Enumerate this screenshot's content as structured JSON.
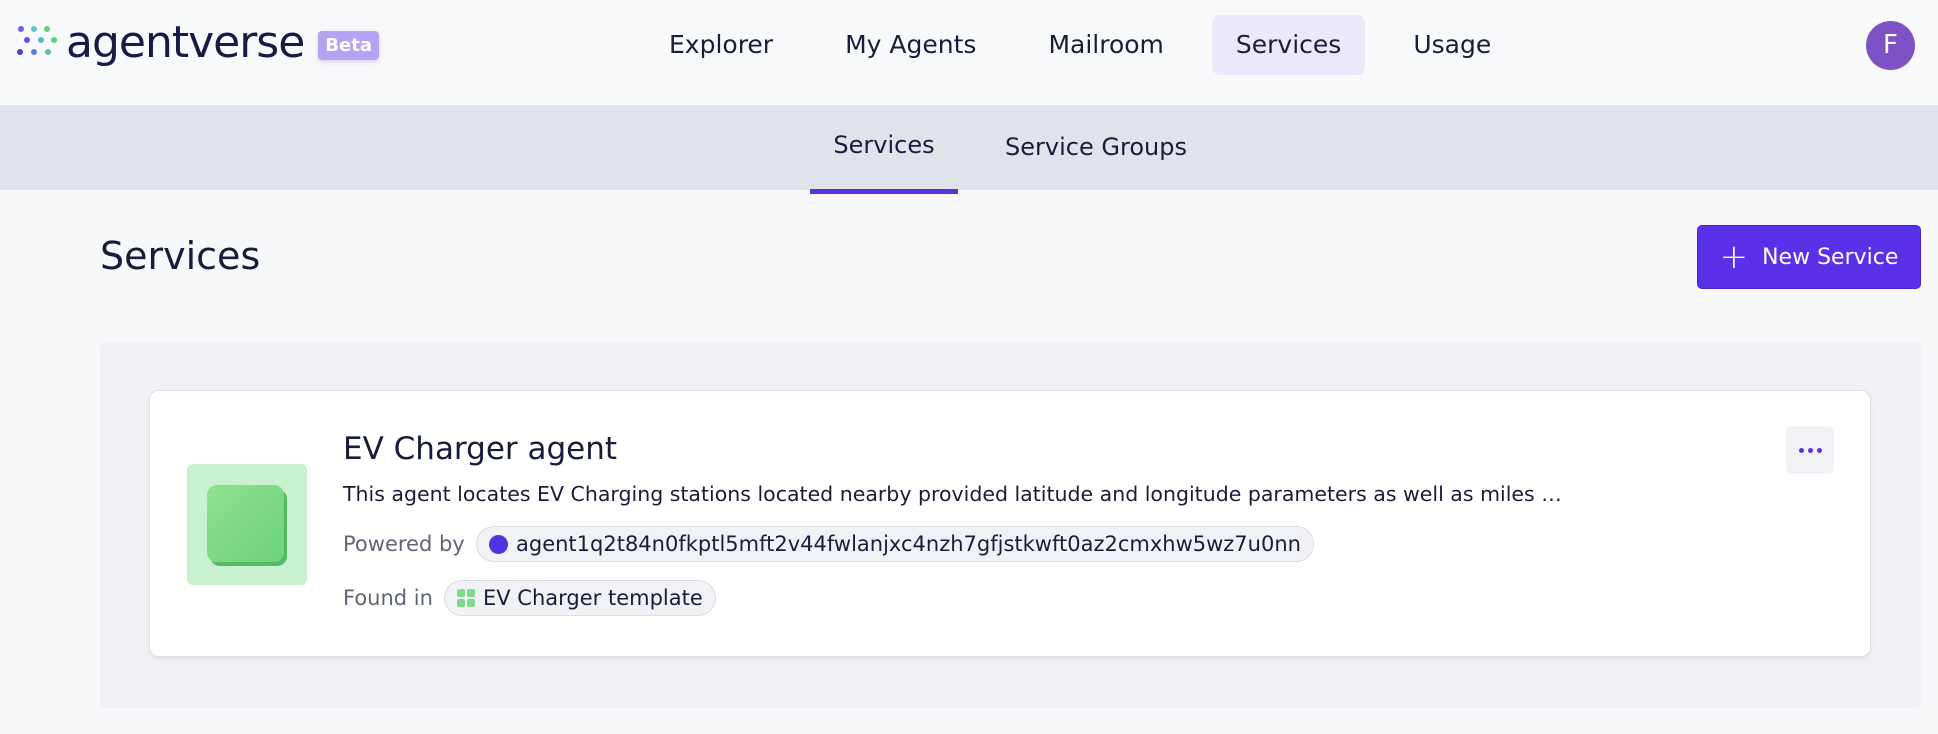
{
  "brand": {
    "name": "agentverse",
    "badge": "Beta"
  },
  "nav": {
    "items": [
      {
        "label": "Explorer"
      },
      {
        "label": "My Agents"
      },
      {
        "label": "Mailroom"
      },
      {
        "label": "Services",
        "active": true
      },
      {
        "label": "Usage"
      }
    ]
  },
  "user": {
    "initial": "F"
  },
  "subtabs": [
    {
      "label": "Services",
      "active": true
    },
    {
      "label": "Service Groups"
    }
  ],
  "page": {
    "title": "Services",
    "new_button_label": "New Service"
  },
  "service_card": {
    "title": "EV Charger agent",
    "description": "This agent locates EV Charging stations located nearby provided latitude and longitude parameters as well as miles …",
    "powered_by_label": "Powered by",
    "agent_address": "agent1q2t84n0fkptl5mft2v44fwlanjxc4nzh7gfjstkwft0az2cmxhw5wz7u0nn",
    "found_in_label": "Found in",
    "template_name": "EV Charger template"
  },
  "colors": {
    "accent": "#5a31e8",
    "avatar": "#7e52c4",
    "thumb_bg": "#c9f1cf",
    "thumb_fg": "#7fd98a"
  }
}
